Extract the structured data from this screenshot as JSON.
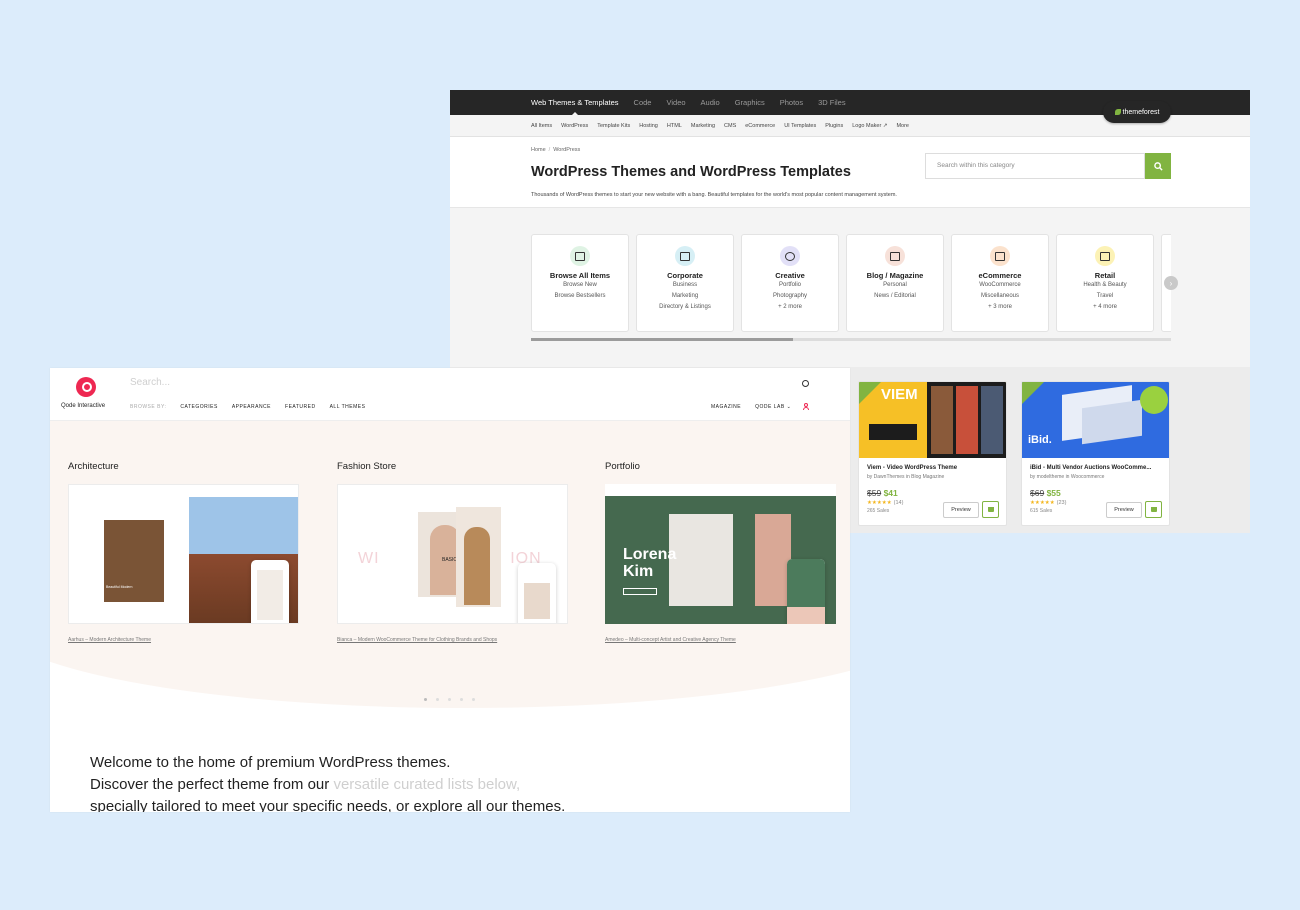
{
  "themeforest": {
    "top_nav": [
      "Web Themes & Templates",
      "Code",
      "Video",
      "Audio",
      "Graphics",
      "Photos",
      "3D Files"
    ],
    "logo_text": "themeforest",
    "sub_nav": [
      "All Items",
      "WordPress",
      "Template Kits",
      "Hosting",
      "HTML",
      "Marketing",
      "CMS",
      "eCommerce",
      "UI Templates",
      "Plugins",
      "Logo Maker ↗",
      "More"
    ],
    "breadcrumb": [
      "Home",
      "WordPress"
    ],
    "title": "WordPress Themes and WordPress Templates",
    "description": "Thousands of WordPress themes to start your new website with a bang. Beautiful templates for the world's most popular content management system.",
    "search_placeholder": "Search within this category",
    "categories": [
      {
        "name": "Browse All Items",
        "lines": [
          "Browse New",
          "Browse Bestsellers"
        ],
        "color": "#dff3e4",
        "icon": "wordpress-icon"
      },
      {
        "name": "Corporate",
        "lines": [
          "Business",
          "Marketing",
          "Directory & Listings"
        ],
        "color": "#d6eff5",
        "icon": "briefcase-icon"
      },
      {
        "name": "Creative",
        "lines": [
          "Portfolio",
          "Photography",
          "+ 2 more"
        ],
        "color": "#e2e0f7",
        "icon": "shapes-icon"
      },
      {
        "name": "Blog / Magazine",
        "lines": [
          "Personal",
          "News / Editorial"
        ],
        "color": "#f7e1d9",
        "icon": "newspaper-icon"
      },
      {
        "name": "eCommerce",
        "lines": [
          "WooCommerce",
          "Miscellaneous",
          "+ 3 more"
        ],
        "color": "#fbe2cd",
        "icon": "cart-icon"
      },
      {
        "name": "Retail",
        "lines": [
          "Health & Beauty",
          "Travel",
          "+ 4 more"
        ],
        "color": "#fcf2b5",
        "icon": "store-icon"
      }
    ],
    "products": [
      {
        "title": "Viem - Video WordPress Theme",
        "by": "by DawnThemes in Blog Magazine",
        "old_price": "$59",
        "price": "$41",
        "stars": "★★★★★",
        "reviews": "(14)",
        "sales": "265 Sales",
        "preview": "Preview",
        "banner_text": "VIEM"
      },
      {
        "title": "iBid - Multi Vendor Auctions WooComme...",
        "by": "by modeltheme in Woocommerce",
        "old_price": "$69",
        "price": "$55",
        "stars": "★★★★★",
        "reviews": "(23)",
        "sales": "615 Sales",
        "preview": "Preview",
        "banner_text": "iBid."
      }
    ]
  },
  "qode": {
    "search_placeholder": "Search...",
    "logo_text": "Qode Interactive",
    "nav": {
      "browse_by": "BROWSE BY:",
      "items": [
        "CATEGORIES",
        "APPEARANCE",
        "FEATURED",
        "ALL THEMES"
      ]
    },
    "right_nav": [
      "MAGAZINE",
      "QODE LAB ⌄"
    ],
    "columns": [
      {
        "heading": "Architecture",
        "caption": "Aarhus – Modern Architecture Theme",
        "shot_text": "Beautiful Modern"
      },
      {
        "heading": "Fashion Store",
        "caption": "Bianca – Modern WooCommerce Theme for Clothing Brands and Shops",
        "shot_text": "BASICS"
      },
      {
        "heading": "Portfolio",
        "caption": "Amedeo – Multi-concept Artist and Creative Agency Theme",
        "shot_text": "Lorena Kim"
      }
    ],
    "welcome": {
      "line1": "Welcome to the home of premium WordPress themes.",
      "line2_a": "Discover the perfect theme from our ",
      "line2_b": "versatile curated lists below,",
      "line3": "specially tailored to meet your specific needs, or explore all our themes."
    }
  }
}
